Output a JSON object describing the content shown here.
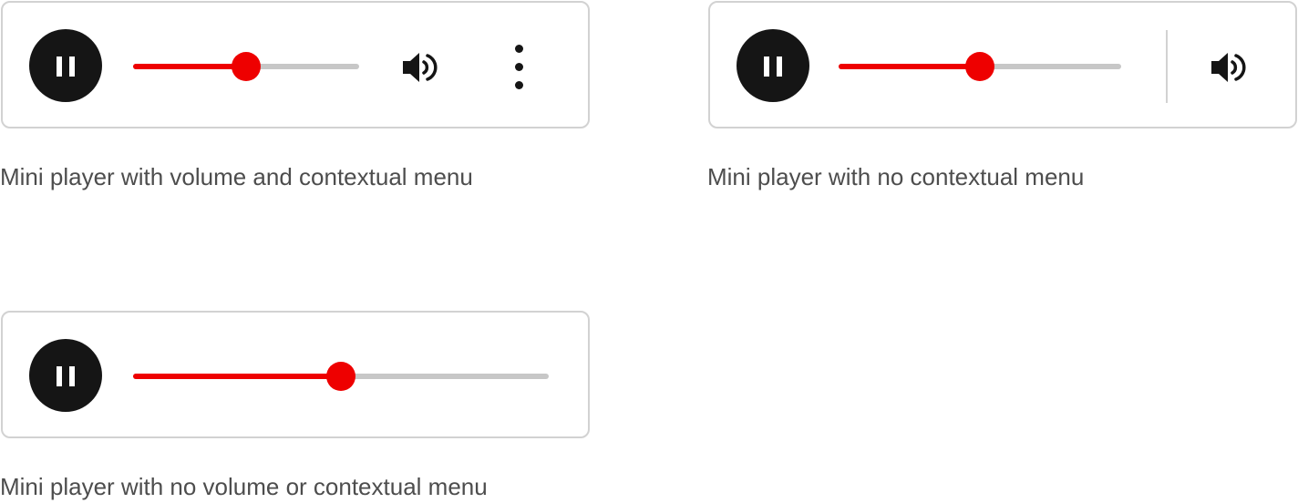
{
  "colors": {
    "accent": "#ee0000",
    "track": "#c7c7c7",
    "button": "#151515",
    "border": "#d2d2d2",
    "caption": "#4d4d4d"
  },
  "players": [
    {
      "id": "player1",
      "progress": 0.5,
      "has_volume": true,
      "has_contextual_menu": true,
      "play_icon": "pause-icon",
      "volume_icon": "volume-icon",
      "menu_icon": "kebab-menu-icon",
      "caption": "Mini player with volume and contextual menu"
    },
    {
      "id": "player2",
      "progress": 0.5,
      "has_volume": true,
      "has_contextual_menu": false,
      "play_icon": "pause-icon",
      "volume_icon": "volume-icon",
      "caption": "Mini player with no contextual menu"
    },
    {
      "id": "player3",
      "progress": 0.5,
      "has_volume": false,
      "has_contextual_menu": false,
      "play_icon": "pause-icon",
      "caption": "Mini player with no volume or contextual menu"
    }
  ]
}
